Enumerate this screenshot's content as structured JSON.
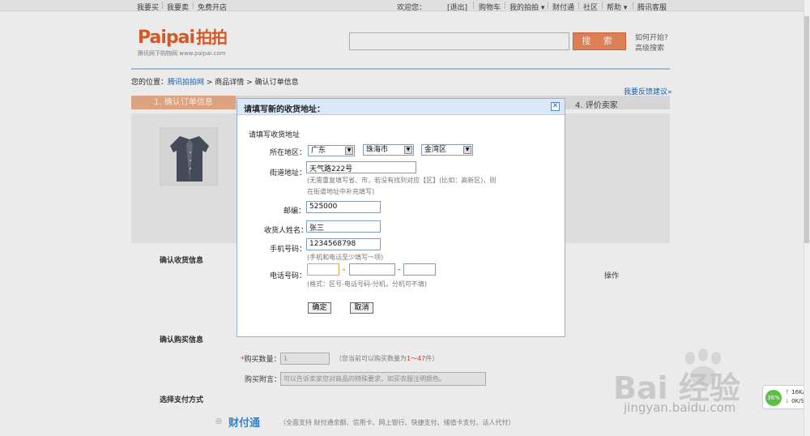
{
  "topbar": {
    "left": [
      "我要买",
      "|",
      "我要卖",
      "|",
      "免费开店"
    ],
    "right": [
      "欢迎您：",
      "[退出]",
      "|",
      "购物车",
      "|",
      "我的拍拍 ▾",
      "|",
      "财付通",
      "|",
      "社区",
      "|",
      "帮助 ▾",
      "|",
      "腾讯客服"
    ]
  },
  "header": {
    "logo": "Paipai",
    "logo_cn": "拍拍",
    "logo_sub": "腾讯网下购物网 www.paipai.com",
    "search_button": "搜 索",
    "how_to": "如何开始?",
    "advanced": "高级搜索"
  },
  "breadcrumb": {
    "prefix": "您的位置：",
    "home": "腾讯拍拍网",
    "sep1": " > ",
    "item": "商品详情",
    "sep2": " > ",
    "current": "确认订单信息"
  },
  "feedback": "我要反馈建议»",
  "steps": {
    "step1": "1. 确认订单信息",
    "step4": "4. 评价卖家"
  },
  "sections": {
    "address": "确认收货信息",
    "col_op": "操作",
    "purchase": "确认购买信息",
    "payment": "选择支付方式"
  },
  "purchase": {
    "qty_star": "*",
    "qty_label": "购买数量：",
    "qty_value": "1",
    "qty_note_pre": "（您当前可以购买数量为",
    "qty_note_num": "1～47",
    "qty_note_post": "件）",
    "msg_label": "购买附言：",
    "msg_placeholder": "可以告诉卖家您对商品的特殊要求，如买衣服注明颜色。"
  },
  "payment": {
    "logo": "财付通",
    "note": "（全面支持 财付通余额、信用卡、网上银行、快捷支付、储值卡支付、话人代付）"
  },
  "dialog": {
    "title": "请填写新的收货地址：",
    "close": "✕",
    "section": "请填写收货地址",
    "region_label": "所在地区：",
    "province": "广东",
    "city": "珠海市",
    "district": "金湾区",
    "street_label": "街道地址：",
    "street_value": "天气路222号",
    "street_note1": "(无需重复填写省、市，若没有找到对应【区】(比如：高新区)，则",
    "street_note2": "在街道地址中补充填写)",
    "zip_label": "邮编：",
    "zip_value": "525000",
    "name_label": "收货人姓名：",
    "name_value": "张三",
    "mobile_label": "手机号码：",
    "mobile_value": "1234568798",
    "mobile_note": "(手机和电话至少填写一项)",
    "phone_label": "电话号码：",
    "phone_dash": "-",
    "phone_note": "(格式：区号-电话号码-分机，分机可不填)",
    "confirm": "确定",
    "cancel": "取消"
  },
  "watermark": {
    "brand": "Bai 经验",
    "url": "jingyan.baidu.com"
  },
  "net": {
    "percent": "36%",
    "up": "16K/S",
    "down": "0K/S"
  },
  "colors": {
    "accent": "#f08a5d",
    "link": "#1a66b3",
    "dialog_head": "#dbe8f7"
  }
}
